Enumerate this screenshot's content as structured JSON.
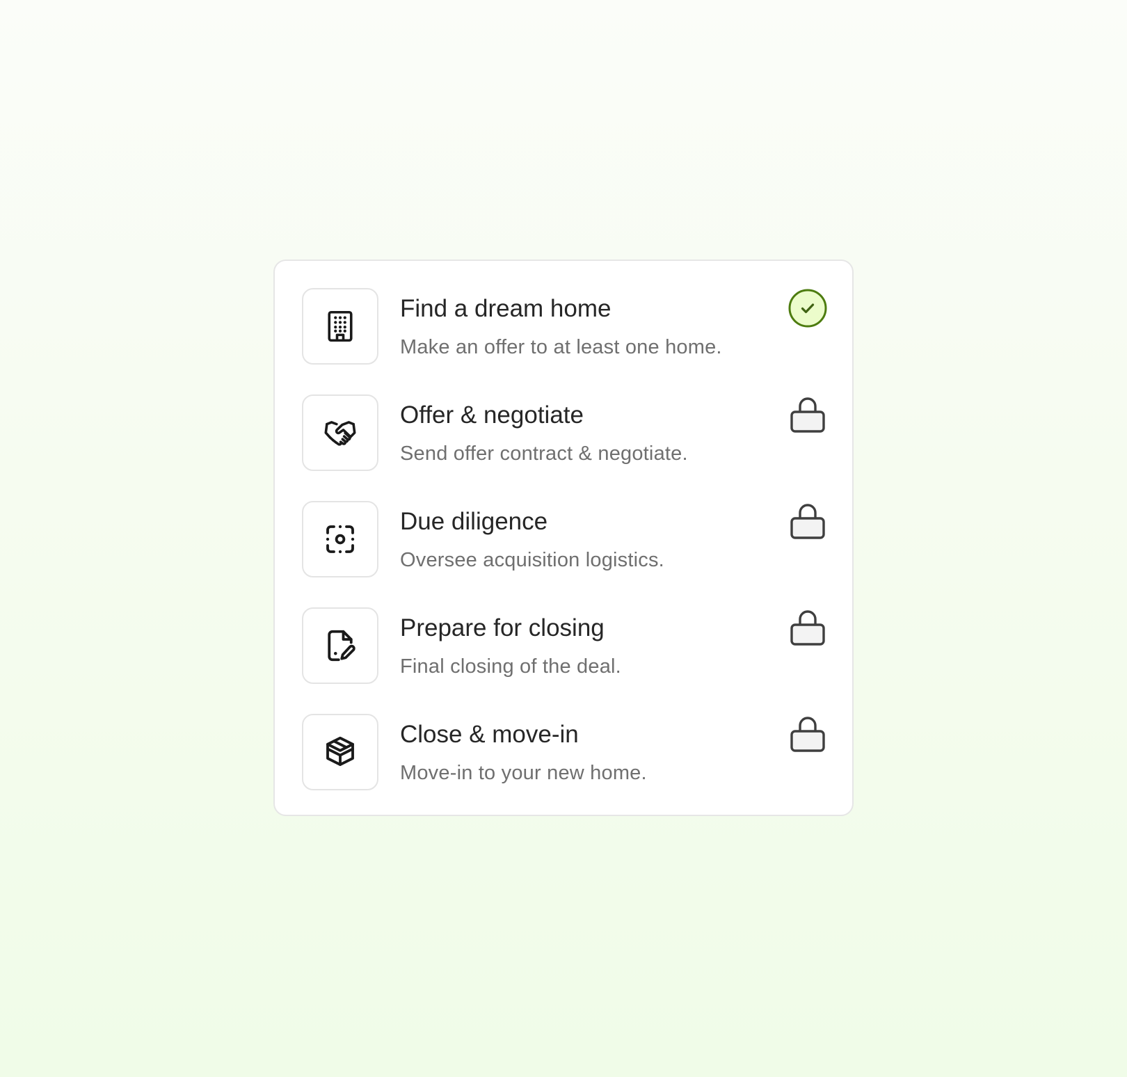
{
  "colors": {
    "complete_ring": "#4d7c0f",
    "complete_fill": "#ecfccb",
    "lock_stroke": "#3f3f3f",
    "lock_fill": "#f3f3f3",
    "icon_stroke": "#1a1a1a"
  },
  "steps": [
    {
      "title": "Find a dream home",
      "description": "Make an offer to at least one home.",
      "icon": "building-icon",
      "status": "completed",
      "status_icon": "check-circle-icon"
    },
    {
      "title": "Offer & negotiate",
      "description": "Send offer contract & negotiate.",
      "icon": "handshake-icon",
      "status": "locked",
      "status_icon": "lock-icon"
    },
    {
      "title": "Due diligence",
      "description": "Oversee acquisition logistics.",
      "icon": "focus-scan-icon",
      "status": "locked",
      "status_icon": "lock-icon"
    },
    {
      "title": "Prepare for closing",
      "description": "Final closing of the deal.",
      "icon": "document-edit-icon",
      "status": "locked",
      "status_icon": "lock-icon"
    },
    {
      "title": "Close & move-in",
      "description": "Move-in to your new home.",
      "icon": "box-icon",
      "status": "locked",
      "status_icon": "lock-icon"
    }
  ]
}
